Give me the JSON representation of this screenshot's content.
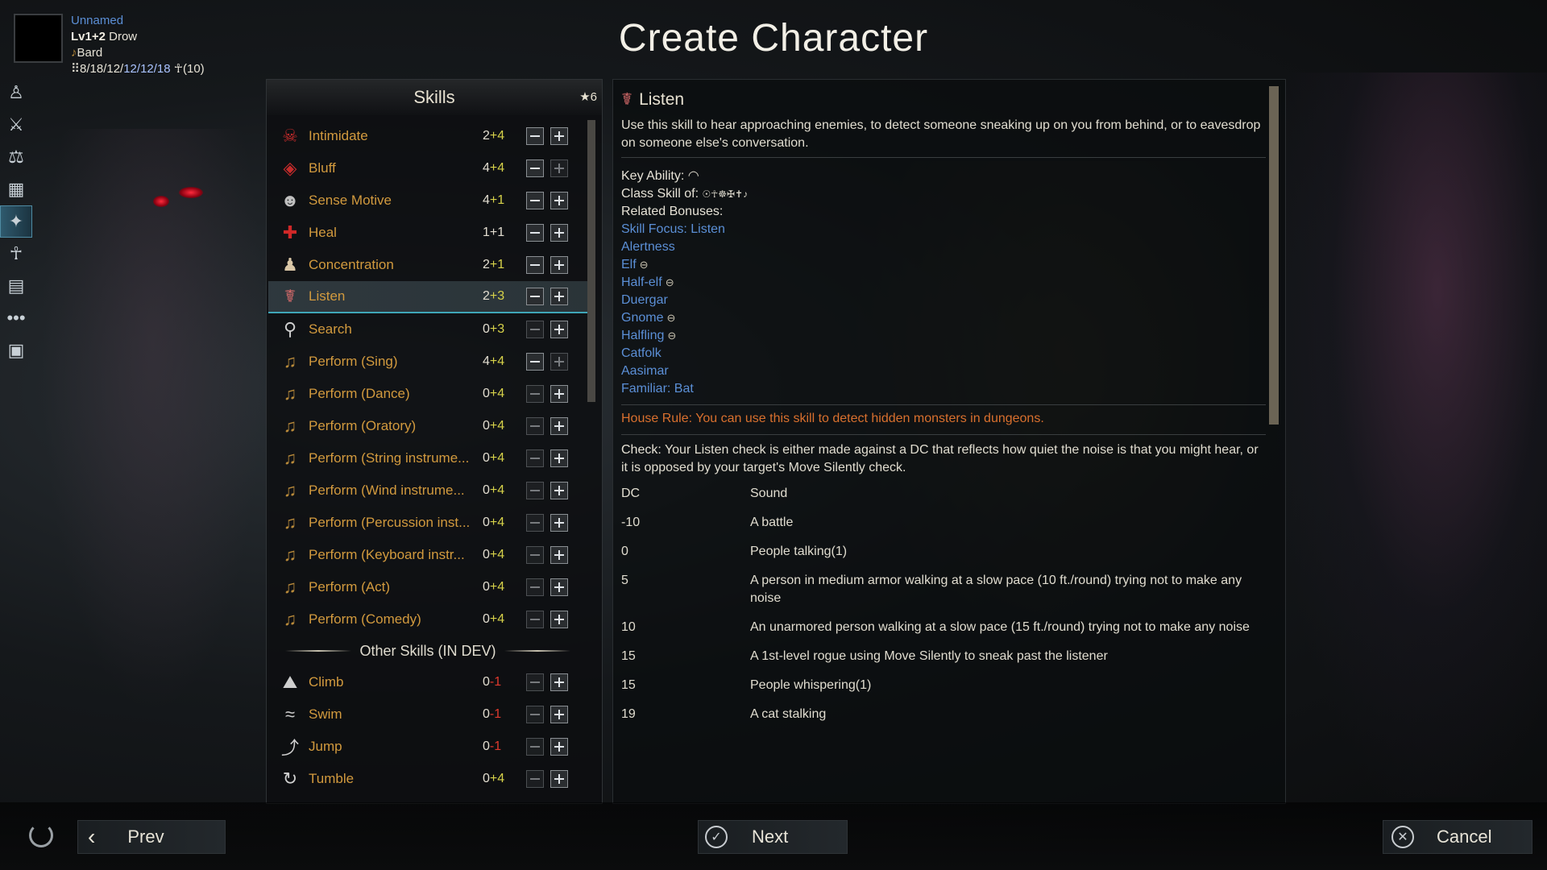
{
  "title": "Create Character",
  "character": {
    "name": "Unnamed",
    "level": "Lv1+2",
    "race": "Drow",
    "class": "Bard",
    "stats_a": "8/18/12/",
    "stats_b": "12/12/18",
    "stats_c": "(10)"
  },
  "skills_panel": {
    "title": "Skills",
    "points": "6",
    "skills": [
      {
        "name": "Intimidate",
        "base": "2",
        "bonus": "+4",
        "icon": "intimidate-icon"
      },
      {
        "name": "Bluff",
        "base": "4",
        "bonus": "+4",
        "icon": "bluff-icon"
      },
      {
        "name": "Sense Motive",
        "base": "4",
        "bonus": "+1",
        "icon": "sense-motive-icon"
      },
      {
        "name": "Heal",
        "base": "1",
        "bonus": "+1",
        "icon": "heal-icon"
      },
      {
        "name": "Concentration",
        "base": "2",
        "bonus": "+1",
        "icon": "concentration-icon"
      },
      {
        "name": "Listen",
        "base": "2",
        "bonus": "+3",
        "icon": "listen-icon"
      },
      {
        "name": "Search",
        "base": "0",
        "bonus": "+3",
        "icon": "search-icon"
      },
      {
        "name": "Perform (Sing)",
        "base": "4",
        "bonus": "+4",
        "icon": "lyre-icon"
      },
      {
        "name": "Perform (Dance)",
        "base": "0",
        "bonus": "+4",
        "icon": "lyre-icon"
      },
      {
        "name": "Perform (Oratory)",
        "base": "0",
        "bonus": "+4",
        "icon": "lyre-icon"
      },
      {
        "name": "Perform (String instrume...",
        "base": "0",
        "bonus": "+4",
        "icon": "lyre-icon"
      },
      {
        "name": "Perform (Wind instrume...",
        "base": "0",
        "bonus": "+4",
        "icon": "lyre-icon"
      },
      {
        "name": "Perform (Percussion inst...",
        "base": "0",
        "bonus": "+4",
        "icon": "lyre-icon"
      },
      {
        "name": "Perform (Keyboard instr...",
        "base": "0",
        "bonus": "+4",
        "icon": "lyre-icon"
      },
      {
        "name": "Perform (Act)",
        "base": "0",
        "bonus": "+4",
        "icon": "lyre-icon"
      },
      {
        "name": "Perform (Comedy)",
        "base": "0",
        "bonus": "+4",
        "icon": "lyre-icon"
      }
    ],
    "other_header": "Other Skills (IN DEV)",
    "other_skills": [
      {
        "name": "Climb",
        "base": "0",
        "bonus": "-1",
        "icon": "climb-icon"
      },
      {
        "name": "Swim",
        "base": "0",
        "bonus": "-1",
        "icon": "swim-icon"
      },
      {
        "name": "Jump",
        "base": "0",
        "bonus": "-1",
        "icon": "jump-icon"
      },
      {
        "name": "Tumble",
        "base": "0",
        "bonus": "+4",
        "icon": "tumble-icon"
      }
    ]
  },
  "detail": {
    "title": "Listen",
    "description": "Use this skill to hear approaching enemies, to detect someone sneaking up on you from behind, or to eavesdrop on someone else's conversation.",
    "key_ability_label": "Key Ability:",
    "class_skill_label": "Class Skill of:",
    "related_label": "Related Bonuses:",
    "related": [
      "Skill Focus: Listen",
      "Alertness",
      "Elf",
      "Half-elf",
      "Duergar",
      "Gnome",
      "Halfling",
      "Catfolk",
      "Aasimar",
      "Familiar: Bat"
    ],
    "house_rule": "House Rule: You can use this skill to detect hidden monsters in dungeons.",
    "check_label": "Check:",
    "check_text": "Your Listen check is either made against a DC that reflects how quiet the noise is that you might hear, or it is opposed by your target's Move Silently check.",
    "table_headers": {
      "dc": "DC",
      "sound": "Sound"
    },
    "table_rows": [
      {
        "dc": "-10",
        "sound": "A battle"
      },
      {
        "dc": "0",
        "sound": "People talking(1)"
      },
      {
        "dc": "5",
        "sound": "A person in medium armor walking at a slow pace (10 ft./round) trying not to make any noise"
      },
      {
        "dc": "10",
        "sound": "An unarmored person walking at a slow pace (15 ft./round) trying not to make any noise"
      },
      {
        "dc": "15",
        "sound": "A 1st-level rogue using Move Silently to sneak past the listener"
      },
      {
        "dc": "15",
        "sound": "People whispering(1)"
      },
      {
        "dc": "19",
        "sound": "A cat stalking"
      }
    ]
  },
  "buttons": {
    "prev": "Prev",
    "next": "Next",
    "cancel": "Cancel"
  }
}
